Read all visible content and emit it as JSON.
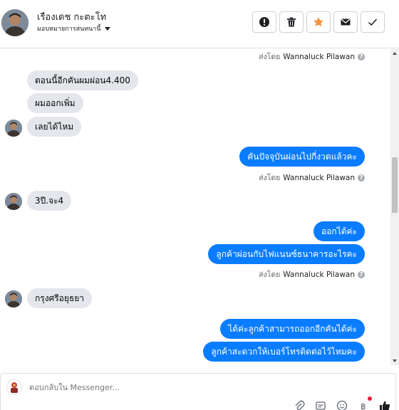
{
  "header": {
    "contact_name": "เรืองเดช กะตะโท",
    "assign_label": "มอบหมายการสนทนานี้",
    "actions": [
      {
        "icon": "alert-icon",
        "name": "mark-spam-button"
      },
      {
        "icon": "trash-icon",
        "name": "delete-button"
      },
      {
        "icon": "star-icon",
        "name": "star-button"
      },
      {
        "icon": "mail-icon",
        "name": "mark-unread-button"
      },
      {
        "icon": "check-icon",
        "name": "mark-done-button"
      }
    ]
  },
  "conversation": {
    "sent_by_prefix": "ส่งโดย",
    "sent_by_name": "Wannaluck Pilawan",
    "messages": [
      {
        "from": "contact",
        "text": "ตอนนี้อีกคันผมผ่อน4.400"
      },
      {
        "from": "contact",
        "text": "ผมออกเพิ่ม"
      },
      {
        "from": "contact",
        "text": "เลยได้ไหม"
      },
      {
        "from": "page",
        "text": "คันปัจจุบันผ่อนไปกี่งวดแล้วคะ"
      },
      {
        "from": "contact",
        "text": "3ปี.จะ4"
      },
      {
        "from": "page",
        "text": "ออกได้ค่ะ"
      },
      {
        "from": "page",
        "text": "ลูกค้าผ่อนกับไฟแนนซ์ธนาคารอะไรคะ"
      },
      {
        "from": "contact",
        "text": "กรุงศรีอยุธยา"
      },
      {
        "from": "page",
        "text": "ได้ค่ะลูกค้าสามารถออกอีกคันได้ค่ะ"
      },
      {
        "from": "page",
        "text": "ลูกค้าสะดวกให้เบอร์โทรติดต่อไว้ไหมคะ"
      }
    ]
  },
  "composer": {
    "placeholder": "ตอบกลับใน Messenger...",
    "tools": [
      "attach-icon",
      "saved-reply-icon",
      "emoji-icon",
      "dollar-tag-icon",
      "like-icon"
    ]
  },
  "colors": {
    "outgoing_bubble": "#0a7cff",
    "incoming_bubble": "#e4e6eb",
    "star": "#f7923b"
  }
}
